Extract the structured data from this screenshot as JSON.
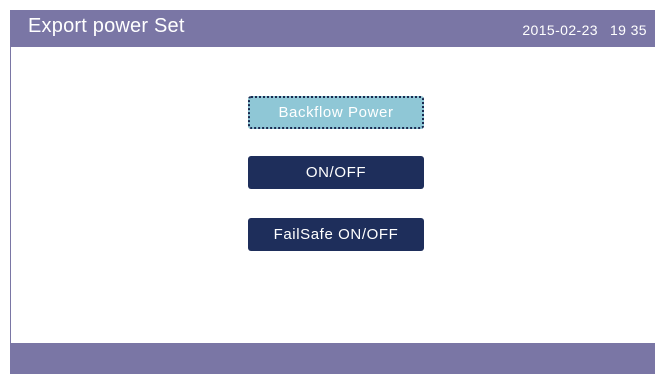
{
  "header": {
    "title": "Export power Set",
    "date": "2015-02-23",
    "time": "19 35"
  },
  "menu": {
    "items": [
      {
        "label": "Backflow Power",
        "selected": true
      },
      {
        "label": "ON/OFF",
        "selected": false
      },
      {
        "label": "FailSafe ON/OFF",
        "selected": false
      }
    ]
  },
  "colors": {
    "bar": "#7a76a5",
    "button": "#1e2e5b",
    "button_selected": "#8fc7d6"
  }
}
